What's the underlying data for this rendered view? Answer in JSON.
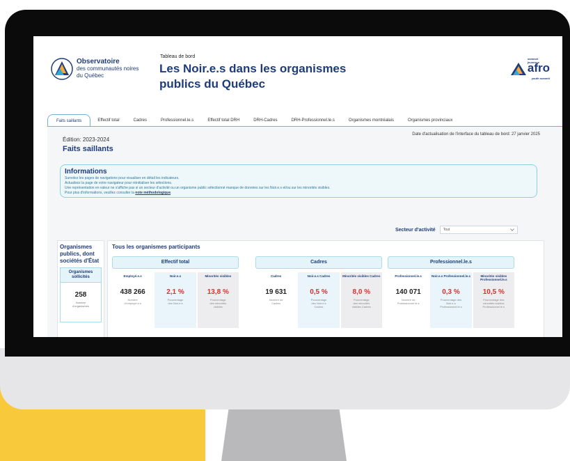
{
  "header": {
    "logo_line1": "Observatoire",
    "logo_line2": "des communautés noires",
    "logo_line3": "du Québec",
    "kicker": "Tableau de bord",
    "title_line1": "Les Noir.e.s dans les organismes",
    "title_line2": "publics du Québec",
    "partner_word": "afro",
    "partner_tag_top": "sommet jeunesse",
    "partner_tag_bottom": "youth summit"
  },
  "tabs": [
    {
      "label": "Faits saillants",
      "active": true
    },
    {
      "label": "Effectif total"
    },
    {
      "label": "Cadres"
    },
    {
      "label": "Professionnel.le.s"
    },
    {
      "label": "Effectif total DRH"
    },
    {
      "label": "DRH-Cadres"
    },
    {
      "label": "DRH-Professionnel.le.s"
    },
    {
      "label": "Organismes montréalais"
    },
    {
      "label": "Organismes provinciaux"
    }
  ],
  "content": {
    "edition": "Édition: 2023-2024",
    "section_title": "Faits saillants",
    "update_date": "Date d'actualisation de l'interface du tableau de bord: 27 janvier 2025"
  },
  "info": {
    "title": "Informations",
    "line1": "Survolez les pages de navigations pour visualiser en détail les indicateurs.",
    "line2": "Actualisez la page de votre navigateur pour réinitialiser les sélections.",
    "line3": "Une représentation en valeur ne s'affiche pas si un secteur d'activité ou un organisme public sélectionné manque de données sur les Noir.e.s et/ou sur les minorités visibles.",
    "line4_prefix": "Pour plus d'informations, veuillez consulter la ",
    "line4_link": "note méthodologique",
    "line4_suffix": "."
  },
  "filter": {
    "label": "Secteur d'activité",
    "value": "Tout"
  },
  "left_card": {
    "title_line1": "Organismes",
    "title_line2": "publics, dont",
    "title_line3": "sociétés d'État",
    "sub_line1": "Organismes",
    "sub_line2": "sollicités",
    "value": "258",
    "caption_line1": "Nombre",
    "caption_line2": "d'organismes"
  },
  "main_card": {
    "title": "Tous les organismes participants",
    "groups": [
      {
        "header": "Effectif total",
        "stats": [
          {
            "head": "Employé.e.s",
            "value": "438 266",
            "cap1": "Nombre",
            "cap2": "d'employé.e.s",
            "cap3": ""
          },
          {
            "head": "Noir.e.s",
            "value": "2,1 %",
            "cap1": "Pourcentage",
            "cap2": "des Noir.e.s",
            "cap3": ""
          },
          {
            "head": "Minorités visibles",
            "value": "13,8 %",
            "cap1": "Pourcentage",
            "cap2": "des minorités",
            "cap3": "visibles"
          }
        ]
      },
      {
        "header": "Cadres",
        "stats": [
          {
            "head": "Cadres",
            "value": "19 631",
            "cap1": "Nombre de",
            "cap2": "Cadres",
            "cap3": ""
          },
          {
            "head": "Noir.e.s Cadres",
            "value": "0,5 %",
            "cap1": "Pourcentage",
            "cap2": "des Noir.e.s",
            "cap3": "Cadres"
          },
          {
            "head": "Minorités visibles Cadres",
            "value": "8,0 %",
            "cap1": "Pourcentage",
            "cap2": "des minorités",
            "cap3": "visibles Cadres"
          }
        ]
      },
      {
        "header": "Professionnel.le.s",
        "stats": [
          {
            "head": "Professionnel.le.s",
            "value": "140 071",
            "cap1": "Nombre de",
            "cap2": "Professionnel.le.s",
            "cap3": ""
          },
          {
            "head": "Noir.e.s Professionnel.le.s",
            "value": "0,3 %",
            "cap1": "Pourcentage des",
            "cap2": "Noir.e.s",
            "cap3": "Professionnel.le.s"
          },
          {
            "head": "Minorités visibles Professionnel.le.s",
            "value": "10,5 %",
            "cap1": "Pourcentage des",
            "cap2": "minorités visibles",
            "cap3": "Professionnel.le.s"
          }
        ]
      }
    ]
  },
  "colors": {
    "navy": "#1f3c7a",
    "accent_red": "#d9322f",
    "info_teal": "#2b7a9b",
    "yellow": "#f9c93c"
  }
}
